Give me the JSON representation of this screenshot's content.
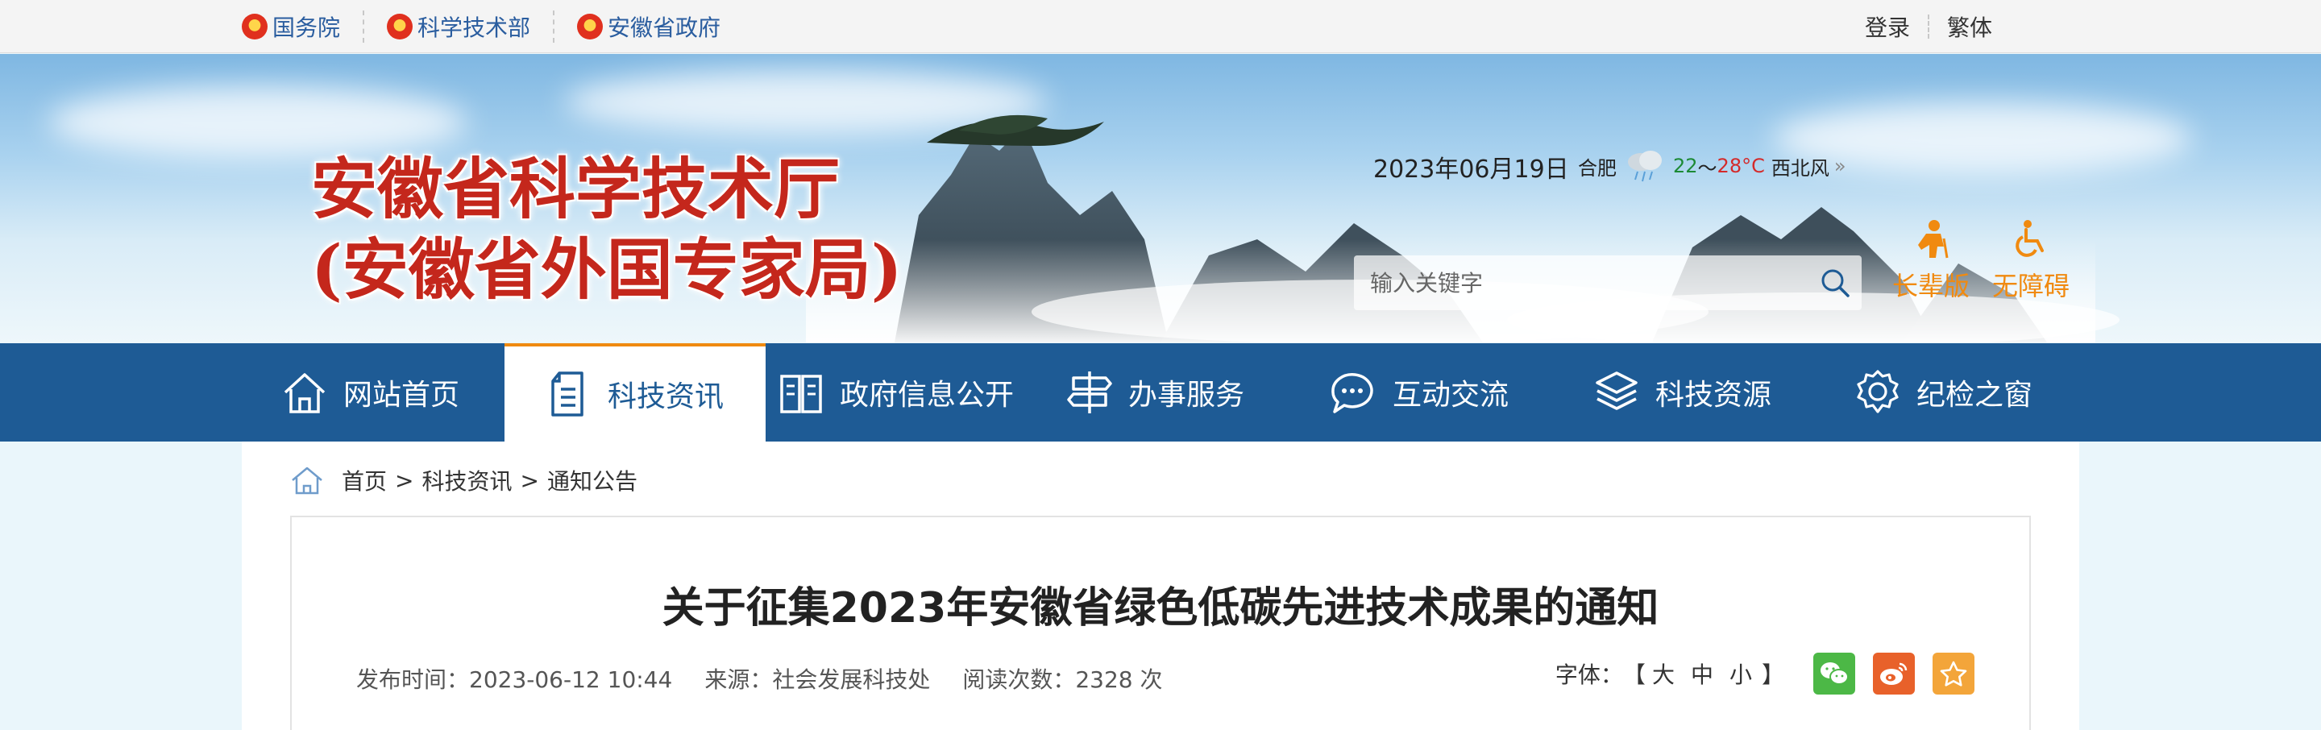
{
  "topbar": {
    "links": [
      {
        "label": "国务院"
      },
      {
        "label": "科学技术部"
      },
      {
        "label": "安徽省政府"
      }
    ],
    "login": "登录",
    "traditional": "繁体"
  },
  "banner": {
    "title_line1": "安徽省科学技术厅",
    "title_line2": "(安徽省外国专家局)",
    "date": "2023年06月19日",
    "weather": {
      "city": "合肥",
      "low": "22",
      "range_sep": "～",
      "high": "28°C",
      "wind": "西北风",
      "more": "»",
      "icon": "cloud-rain-icon"
    },
    "search": {
      "placeholder": "输入关键字",
      "icon": "search-icon"
    },
    "accessibility": [
      {
        "label": "长辈版",
        "icon": "elder-icon"
      },
      {
        "label": "无障碍",
        "icon": "wheelchair-icon"
      }
    ],
    "accent_color": "#f08a10",
    "title_color": "#c4271c"
  },
  "nav": {
    "color": "#1e5b95",
    "items": [
      {
        "label": "网站首页",
        "icon": "home-icon"
      },
      {
        "label": "科技资讯",
        "icon": "document-icon",
        "active": true
      },
      {
        "label": "政府信息公开",
        "icon": "book-icon"
      },
      {
        "label": "办事服务",
        "icon": "signpost-icon"
      },
      {
        "label": "互动交流",
        "icon": "chat-icon"
      },
      {
        "label": "科技资源",
        "icon": "cube-icon"
      },
      {
        "label": "纪检之窗",
        "icon": "badge-icon"
      }
    ]
  },
  "breadcrumb": {
    "items": [
      "首页",
      "科技资讯",
      "通知公告"
    ],
    "separator": ">"
  },
  "article": {
    "title": "关于征集2023年安徽省绿色低碳先进技术成果的通知",
    "publish_time": "发布时间：2023-06-12 10:44",
    "source": "来源：社会发展科技处",
    "views": "阅读次数：2328 次",
    "font_label": "字体：",
    "font_open": "【",
    "font_sizes": [
      "大",
      "中",
      "小"
    ],
    "font_close": "】",
    "share": [
      {
        "name": "wechat-icon",
        "color": "#4cb846"
      },
      {
        "name": "weibo-icon",
        "color": "#e8612a"
      },
      {
        "name": "favorite-icon",
        "color": "#f3a53a"
      }
    ]
  }
}
